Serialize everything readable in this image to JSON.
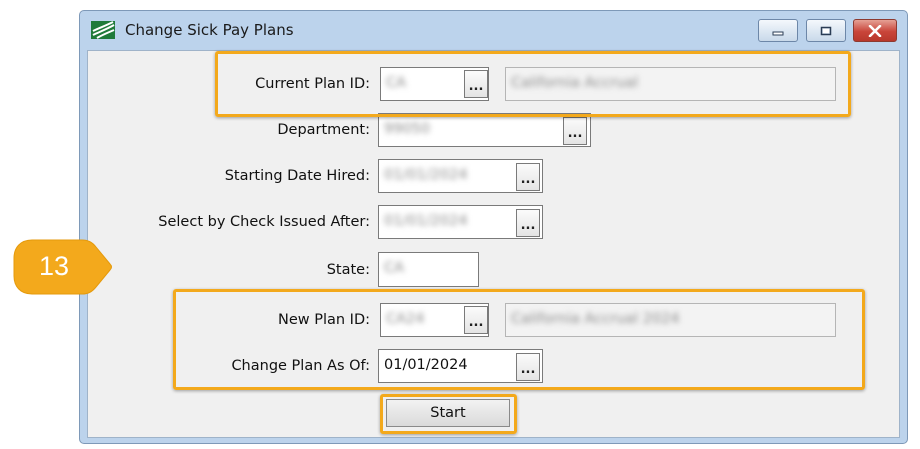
{
  "window": {
    "title": "Change Sick Pay Plans",
    "controls": {
      "minimize_icon": "minimize-icon",
      "maximize_icon": "maximize-icon",
      "close_icon": "close-icon"
    }
  },
  "form": {
    "current_plan": {
      "label": "Current Plan ID:",
      "id_value": "CA",
      "description": "California Accrual"
    },
    "department": {
      "label": "Department:",
      "value": "99050"
    },
    "starting_date_hired": {
      "label": "Starting Date Hired:",
      "value": "01/01/2024"
    },
    "check_issued_after": {
      "label": "Select by Check Issued After:",
      "value": "01/01/2024"
    },
    "state": {
      "label": "State:",
      "value": "CA"
    },
    "new_plan": {
      "label": "New Plan ID:",
      "id_value": "CA24",
      "description": "California Accrual 2024"
    },
    "change_plan_as_of": {
      "label": "Change Plan As Of:",
      "value": "01/01/2024"
    },
    "browse_label": "...",
    "start_label": "Start"
  },
  "callout": {
    "number": "13",
    "color": "#f3a91c"
  },
  "colors": {
    "highlight": "#f3a91c",
    "window_frame": "#bcd3ec",
    "client": "#f0f0f0"
  }
}
